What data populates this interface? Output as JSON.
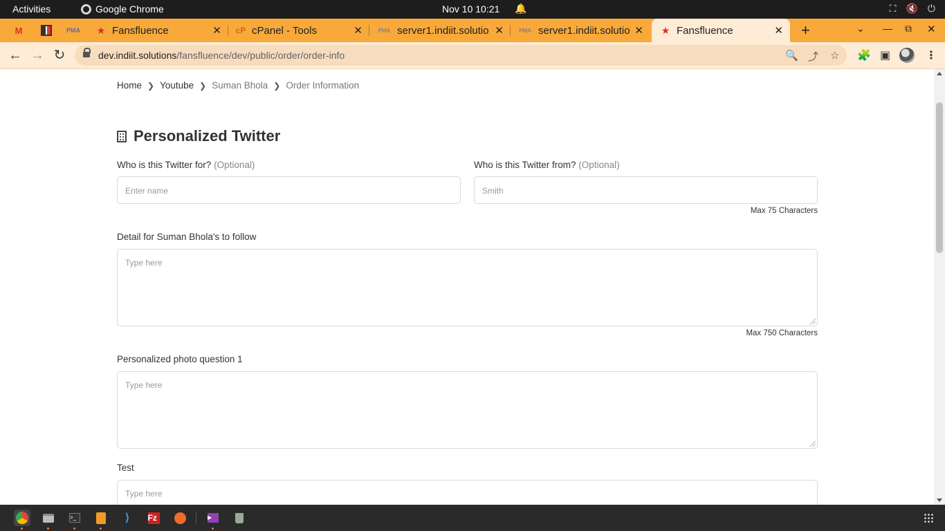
{
  "system_bar": {
    "activities": "Activities",
    "app_name": "Google Chrome",
    "clock": "Nov 10  10:21"
  },
  "tabs": [
    {
      "title": "Fansfluence",
      "icon": "star-logo-icon"
    },
    {
      "title": "cPanel - Tools",
      "icon": "cpanel-icon"
    },
    {
      "title": "server1.indiit.solutio",
      "icon": "pma-icon"
    },
    {
      "title": "server1.indiit.solutio",
      "icon": "pma-icon"
    },
    {
      "title": "Fansfluence",
      "icon": "star-logo-icon",
      "active": true
    }
  ],
  "pinned_tabs": [
    "gmail-icon",
    "app-icon",
    "pma-icon"
  ],
  "address_bar": {
    "host": "dev.indiit.solutions",
    "path": "/fansfluence/dev/public/order/order-info"
  },
  "breadcrumb": {
    "home": "Home",
    "category": "Youtube",
    "person": "Suman Bhola",
    "current": "Order Information"
  },
  "form": {
    "title": "Personalized Twitter",
    "for_label": "Who is this Twitter for?",
    "for_optional": "(Optional)",
    "for_placeholder": "Enter name",
    "from_label": "Who is this Twitter from?",
    "from_optional": "(Optional)",
    "from_placeholder": "Smith",
    "name_max": "Max 75 Characters",
    "detail_label": "Detail for Suman Bhola's to follow",
    "detail_placeholder": "Type here",
    "detail_max": "Max 750 Characters",
    "photo_label": "Personalized photo question 1",
    "photo_placeholder": "Type here",
    "test_label": "Test",
    "test_placeholder": "Type here"
  },
  "colors": {
    "tab_strip": "#f8a93a",
    "toolbar": "#ffecd6",
    "omnibox": "#f7dcbd"
  }
}
